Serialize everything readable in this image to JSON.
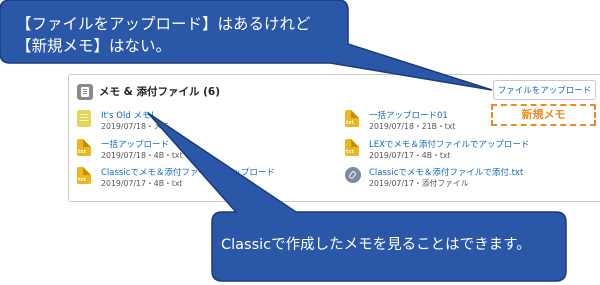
{
  "callout_top": {
    "line1": "【ファイルをアップロード】はあるけれど",
    "line2": "【新規メモ】はない。"
  },
  "callout_bottom": {
    "text": "Classicで作成したメモを見ることはできます。"
  },
  "related_list": {
    "title": "メモ & 添付ファイル (6)",
    "upload_button": "ファイルをアップロード",
    "new_memo_label": "新規メモ",
    "items": [
      {
        "name": "It's Old メモ！",
        "meta": "2019/07/18・メモ",
        "icon": "note-icon"
      },
      {
        "name": "一括アップロード01",
        "meta": "2019/07/18・21B・txt",
        "icon": "txt-file-icon"
      },
      {
        "name": "一括アップロード",
        "meta": "2019/07/18・4B・txt",
        "icon": "txt-file-icon"
      },
      {
        "name": "LEXでメモ＆添付ファイルでアップロード",
        "meta": "2019/07/17・4B・txt",
        "icon": "txt-file-icon"
      },
      {
        "name": "Classicでメモ＆添付ファイルでアップロード",
        "meta": "2019/07/17・4B・txt",
        "icon": "txt-file-icon"
      },
      {
        "name": "Classicでメモ＆添付ファイルで添付.txt",
        "meta": "2019/07/17・添付ファイル",
        "icon": "attachment-icon"
      }
    ]
  },
  "colors": {
    "callout_fill": "#2a57a8",
    "callout_stroke": "#1a3b7a",
    "link": "#0b6ac5",
    "highlight": "#ee8a22"
  }
}
